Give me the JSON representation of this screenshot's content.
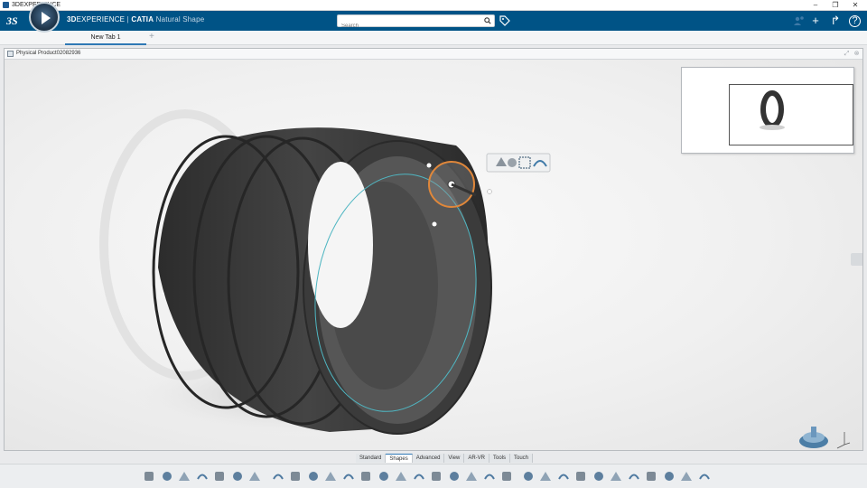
{
  "os": {
    "title": "3DEXPERIENCE",
    "minimize": "–",
    "restore": "❐",
    "close": "✕"
  },
  "header": {
    "brand_prefix": "3D",
    "brand_experience": "EXPERIENCE",
    "brand_separator": " | ",
    "brand_app": "CATIA",
    "brand_module": " Natural Shape",
    "search_placeholder": "Search",
    "add_symbol": "+",
    "share_symbol": "↱",
    "help_symbol": "?"
  },
  "tabs": {
    "active_label": "New Tab 1",
    "add_symbol": "+"
  },
  "document": {
    "title": "Physical Product02082936"
  },
  "section_tabs": [
    "Standard",
    "Shapes",
    "Advanced",
    "View",
    "AR-VR",
    "Tools",
    "Touch"
  ],
  "section_active_index": 1,
  "colors": {
    "header_bg": "#005386",
    "accent": "#2f79b5",
    "model": "#3a3a3a",
    "curve": "#4fb6c2",
    "manipulator": "#e0873a"
  },
  "toolbar_icons": [
    "cut-icon",
    "copy-icon",
    "paste-icon",
    "undo-icon",
    "product-icon",
    "render-icon",
    "eraser-icon",
    "sketch-icon",
    "plane-icon",
    "circle-icon",
    "sphere-icon",
    "solid-icon",
    "box-icon",
    "sweep-icon",
    "revolve-icon",
    "bend-icon",
    "extrude-icon",
    "shell-icon",
    "loft-icon",
    "wrap-icon",
    "dome-icon",
    "brush-icon",
    "blend-icon",
    "curve-icon",
    "axis-icon",
    "mirror-icon",
    "pattern-icon",
    "array-icon",
    "scatter-icon",
    "gear-icon",
    "transform-icon",
    "analysis-icon"
  ]
}
